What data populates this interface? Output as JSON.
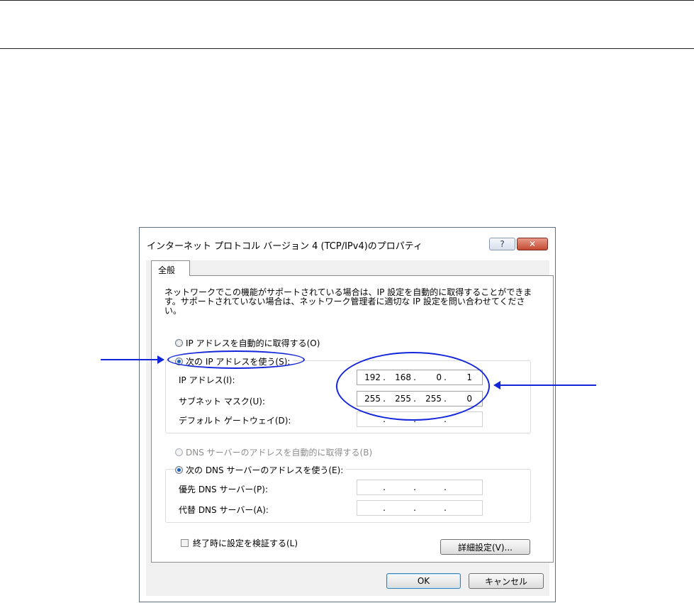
{
  "window": {
    "title": "インターネット プロトコル バージョン 4 (TCP/IPv4)のプロパティ",
    "help_label": "?",
    "close_label": "✕"
  },
  "tab": {
    "label": "全般"
  },
  "description": "ネットワークでこの機能がサポートされている場合は、IP 設定を自動的に取得することができます。サポートされていない場合は、ネットワーク管理者に適切な IP 設定を問い合わせてください。",
  "ip_section": {
    "auto_label": "IP アドレスを自動的に取得する(O)",
    "manual_label": "次の IP アドレスを使う(S):",
    "selected": "manual",
    "ip_address": {
      "label": "IP アドレス(I):",
      "octets": [
        "192",
        "168",
        "0",
        "1"
      ]
    },
    "subnet_mask": {
      "label": "サブネット マスク(U):",
      "octets": [
        "255",
        "255",
        "255",
        "0"
      ]
    },
    "default_gateway": {
      "label": "デフォルト ゲートウェイ(D):",
      "octets": [
        "",
        "",
        "",
        ""
      ]
    }
  },
  "dns_section": {
    "auto_label": "DNS サーバーのアドレスを自動的に取得する(B)",
    "manual_label": "次の DNS サーバーのアドレスを使う(E):",
    "selected": "manual",
    "preferred": {
      "label": "優先 DNS サーバー(P):",
      "octets": [
        "",
        "",
        "",
        ""
      ]
    },
    "alternate": {
      "label": "代替 DNS サーバー(A):",
      "octets": [
        "",
        "",
        "",
        ""
      ]
    }
  },
  "validate_checkbox": {
    "label": "終了時に設定を検証する(L)",
    "checked": false
  },
  "buttons": {
    "advanced": "詳細設定(V)...",
    "ok": "OK",
    "cancel": "キャンセル"
  },
  "colors": {
    "annotation": "#1426d9",
    "radio_selected": "#1f63b9",
    "close_button": "#c44b32"
  }
}
